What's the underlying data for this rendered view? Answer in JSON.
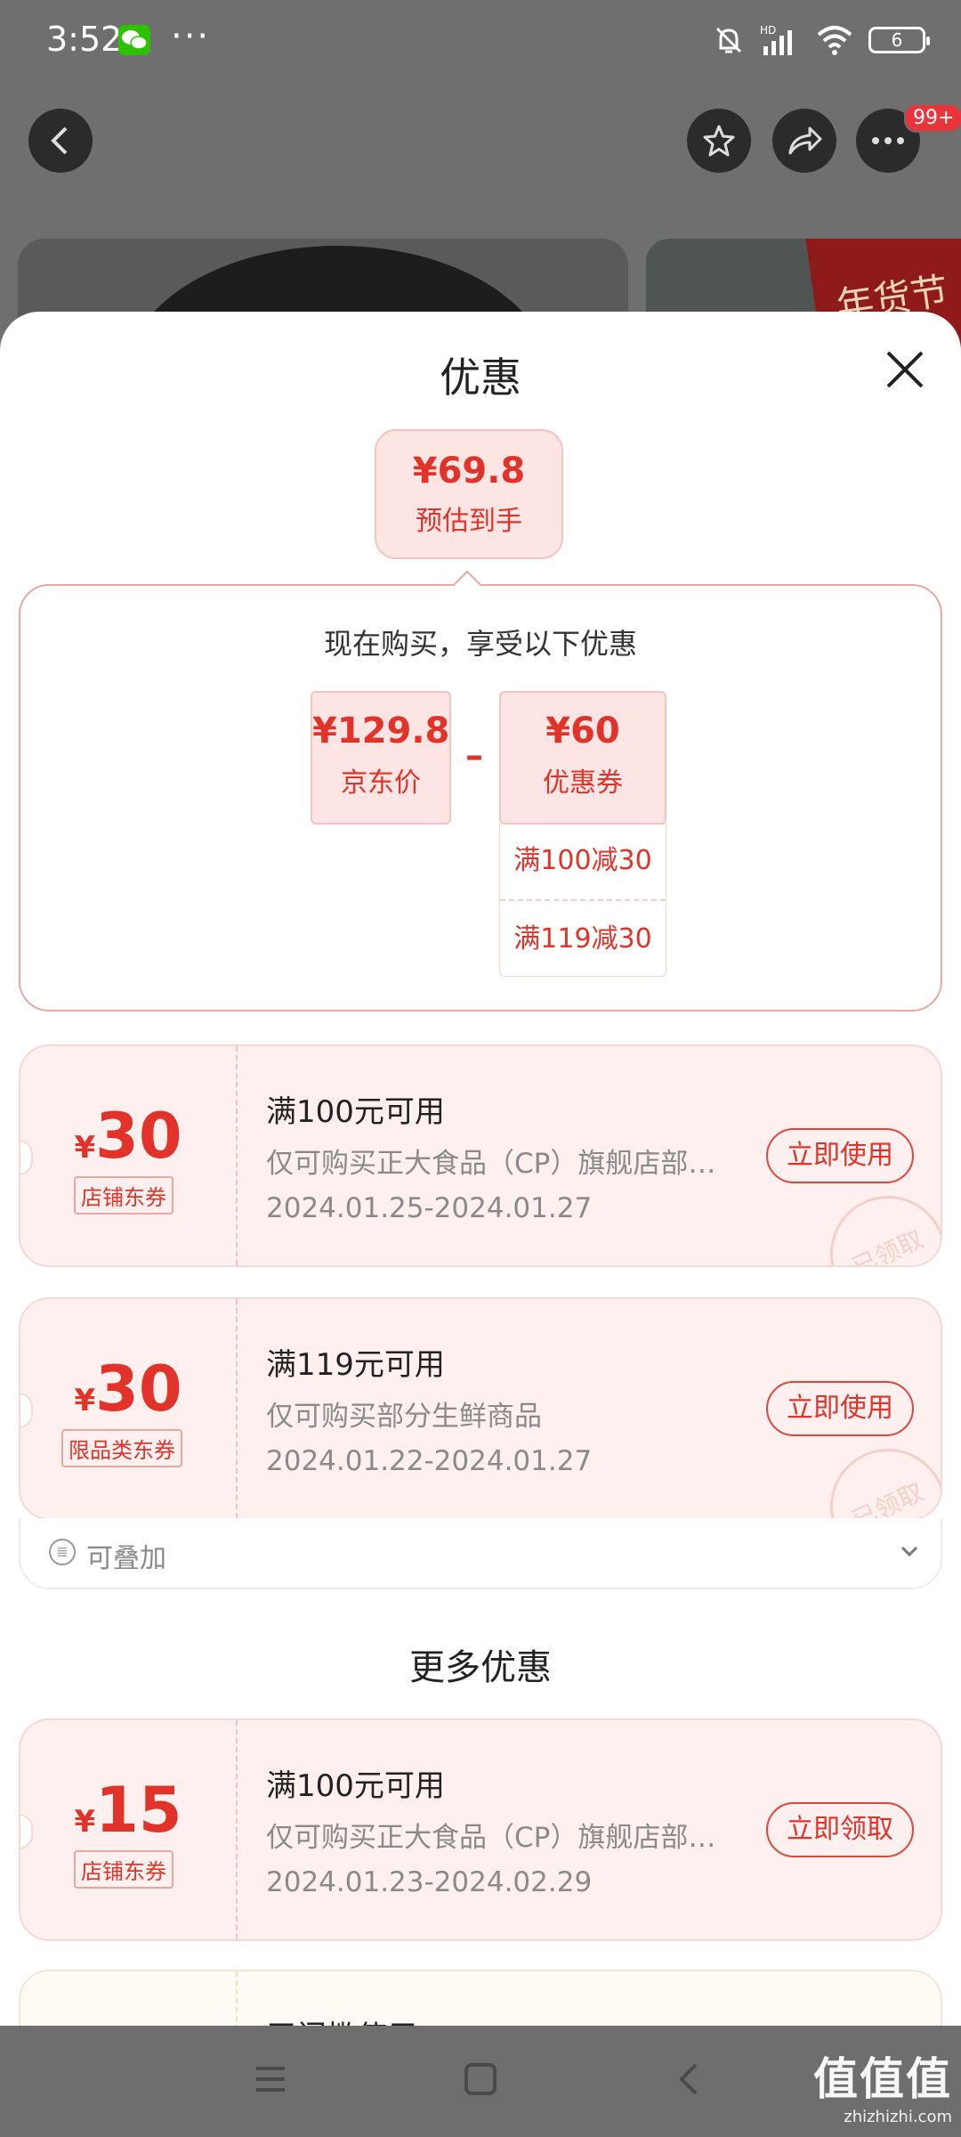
{
  "status_bar": {
    "time": "3:52",
    "battery": "6",
    "hd_label": "HD"
  },
  "header": {
    "badge": "99+"
  },
  "banner": {
    "stamp_text": "年货节"
  },
  "sheet": {
    "title": "优惠",
    "estimate": {
      "price": "¥69.8",
      "label": "预估到手"
    },
    "calc": {
      "heading": "现在购买，享受以下优惠",
      "jd_price": {
        "amount": "¥129.8",
        "label": "京东价"
      },
      "operator": "–",
      "coupon_total": {
        "amount": "¥60",
        "label": "优惠券"
      },
      "coupon_items": [
        "满100减30",
        "满119减30"
      ]
    },
    "coupons": [
      {
        "yen": "¥",
        "amount": "30",
        "tag": "店铺东券",
        "title": "满100元可用",
        "desc": "仅可购买正大食品（CP）旗舰店部…",
        "date": "2024.01.25-2024.01.27",
        "button": "立即使用",
        "stamp": "已领取"
      },
      {
        "yen": "¥",
        "amount": "30",
        "tag": "限品类东券",
        "title": "满119元可用",
        "desc": "仅可购买部分生鲜商品",
        "date": "2024.01.22-2024.01.27",
        "button": "立即使用",
        "stamp": "已领取"
      }
    ],
    "stackable": "可叠加",
    "more_title": "更多优惠",
    "more_coupons": [
      {
        "yen": "¥",
        "amount": "15",
        "tag": "店铺东券",
        "title": "满100元可用",
        "desc": "仅可购买正大食品（CP）旗舰店部…",
        "date": "2024.01.23-2024.02.29",
        "button": "立即领取"
      },
      {
        "title": "无门槛使用"
      }
    ]
  },
  "watermark": {
    "main": "值值值",
    "sub": "zhizhizhi.com"
  }
}
